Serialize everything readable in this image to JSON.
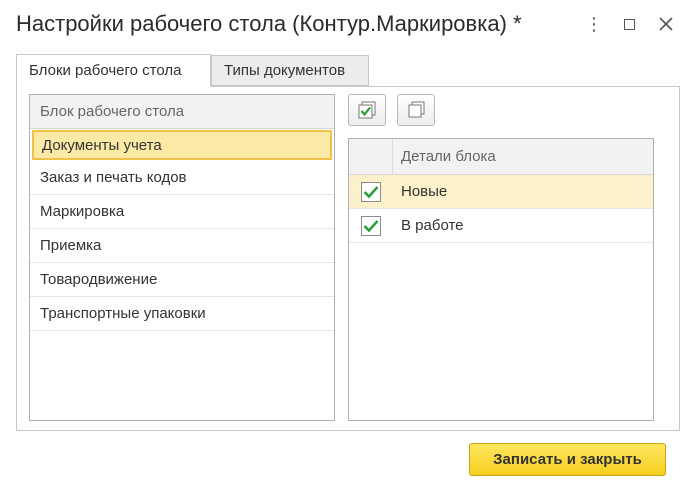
{
  "window": {
    "title": "Настройки рабочего стола (Контур.Маркировка) *",
    "more_icon": "more-vertical-icon",
    "maximize_icon": "maximize-icon",
    "close_icon": "close-icon"
  },
  "tabs": [
    {
      "label": "Блоки рабочего стола",
      "active": true
    },
    {
      "label": "Типы документов",
      "active": false
    }
  ],
  "blocks_table": {
    "header": "Блок рабочего стола",
    "rows": [
      {
        "label": "Документы учета",
        "selected": true
      },
      {
        "label": "Заказ и печать кодов",
        "selected": false
      },
      {
        "label": "Маркировка",
        "selected": false
      },
      {
        "label": "Приемка",
        "selected": false
      },
      {
        "label": "Товародвижение",
        "selected": false
      },
      {
        "label": "Транспортные упаковки",
        "selected": false
      }
    ]
  },
  "toolbar": {
    "check_all_icon": "check-all-icon",
    "uncheck_all_icon": "uncheck-all-icon"
  },
  "details_table": {
    "header": "Детали блока",
    "rows": [
      {
        "label": "Новые",
        "checked": true
      },
      {
        "label": "В работе",
        "checked": true
      }
    ]
  },
  "footer": {
    "save_label": "Записать и закрыть"
  },
  "colors": {
    "accent_yellow": "#f5cf1f",
    "selection_fill": "#fbe9a5",
    "check_green": "#2e9e3a"
  }
}
